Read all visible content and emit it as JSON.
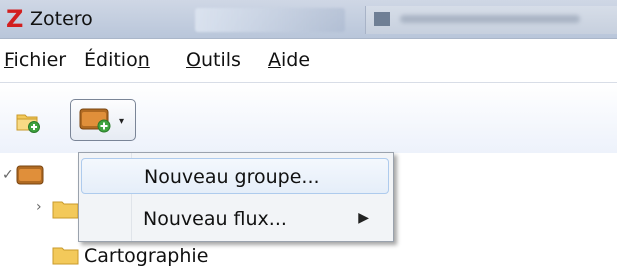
{
  "window": {
    "title": "Zotero",
    "logo": "Z",
    "brand_color": "#d21f1f"
  },
  "menubar": {
    "items": [
      {
        "pre": "",
        "key": "F",
        "post": "ichier"
      },
      {
        "pre": "Éditio",
        "key": "n",
        "post": ""
      },
      {
        "pre": "",
        "key": "O",
        "post": "utils"
      },
      {
        "pre": "",
        "key": "A",
        "post": "ide"
      }
    ]
  },
  "toolbar": {
    "new_collection_icon": "folder-add-icon",
    "new_library_icon": "library-add-icon",
    "dropdown_caret": "▾"
  },
  "tree": {
    "root_twisty": "✓",
    "child_twisty": "›",
    "items": [
      {
        "label": "Cartographie"
      }
    ]
  },
  "dropdown": {
    "items": [
      {
        "label": "Nouveau groupe...",
        "has_submenu": false,
        "highlighted": true
      },
      {
        "label": "Nouveau flux...",
        "has_submenu": true,
        "submenu_arrow": "▶",
        "highlighted": false
      }
    ]
  }
}
